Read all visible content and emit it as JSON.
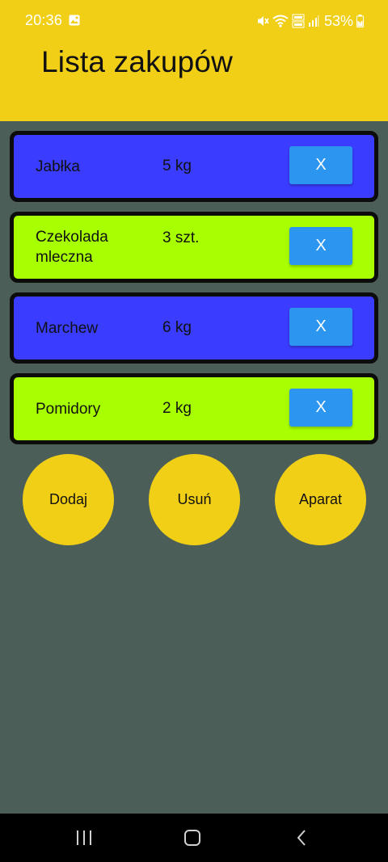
{
  "status_bar": {
    "time": "20:36",
    "battery": "53%"
  },
  "app": {
    "title": "Lista zakupów"
  },
  "items": [
    {
      "name": "Jabłka",
      "qty": "5 kg",
      "remove_label": "X",
      "color": "#3a3cff"
    },
    {
      "name": "Czekolada mleczna",
      "qty": "3 szt.",
      "remove_label": "X",
      "color": "#a8ff00"
    },
    {
      "name": "Marchew",
      "qty": "6 kg",
      "remove_label": "X",
      "color": "#3a3cff"
    },
    {
      "name": "Pomidory",
      "qty": "2 kg",
      "remove_label": "X",
      "color": "#a8ff00"
    }
  ],
  "actions": {
    "add_label": "Dodaj",
    "remove_label": "Usuń",
    "camera_label": "Aparat"
  },
  "nav_icons": [
    "recents-icon",
    "home-icon",
    "back-icon"
  ],
  "colors": {
    "header": "#f2cf17",
    "background": "#4b5e58",
    "button": "#2b95f0"
  }
}
